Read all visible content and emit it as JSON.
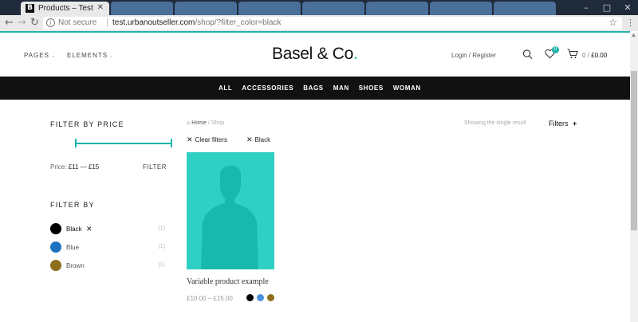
{
  "browser": {
    "active_tab_title": "Products – Test",
    "active_tab_favicon": "B",
    "not_secure": "Not secure",
    "url_host": "test.urbanoutseller.com",
    "url_path": "/shop/?filter_color=black"
  },
  "header": {
    "nav": [
      {
        "label": "PAGES"
      },
      {
        "label": "ELEMENTS"
      }
    ],
    "logo_text": "Basel & Co",
    "logo_dot": ".",
    "login": "Login / Register",
    "wishlist_count": "0",
    "cart_count_prefix": "0 /",
    "cart_total": "£0.00"
  },
  "categories": [
    "ALL",
    "ACCESSORIES",
    "BAGS",
    "MAN",
    "SHOES",
    "WOMAN"
  ],
  "sidebar": {
    "price_title": "FILTER BY PRICE",
    "price_prefix": "Price:",
    "price_range": "£11 — £15",
    "filter_button": "FILTER",
    "filter_by_title": "FILTER BY",
    "colors": [
      {
        "name": "Black",
        "count": "(1)",
        "hex": "#000000",
        "selected": true
      },
      {
        "name": "Blue",
        "count": "(1)",
        "hex": "#1e73be",
        "selected": false
      },
      {
        "name": "Brown",
        "count": "(1)",
        "hex": "#8d6e1a",
        "selected": false
      }
    ]
  },
  "main": {
    "breadcrumb_home": "Home",
    "breadcrumb_sep": "/",
    "breadcrumb_current": "Shop",
    "result_count": "Showing the single result",
    "filters_toggle": "Filters",
    "active_filters": [
      {
        "label": "Clear filters"
      },
      {
        "label": "Black"
      }
    ],
    "product": {
      "title": "Variable product example",
      "price": "£10.00 – £15.00",
      "image_bg": "#2fcfc3",
      "swatches": [
        "#000000",
        "#4a90d9",
        "#8d6e1a"
      ]
    }
  },
  "colors": {
    "accent": "#1fb3a9",
    "catbar": "#111111"
  }
}
